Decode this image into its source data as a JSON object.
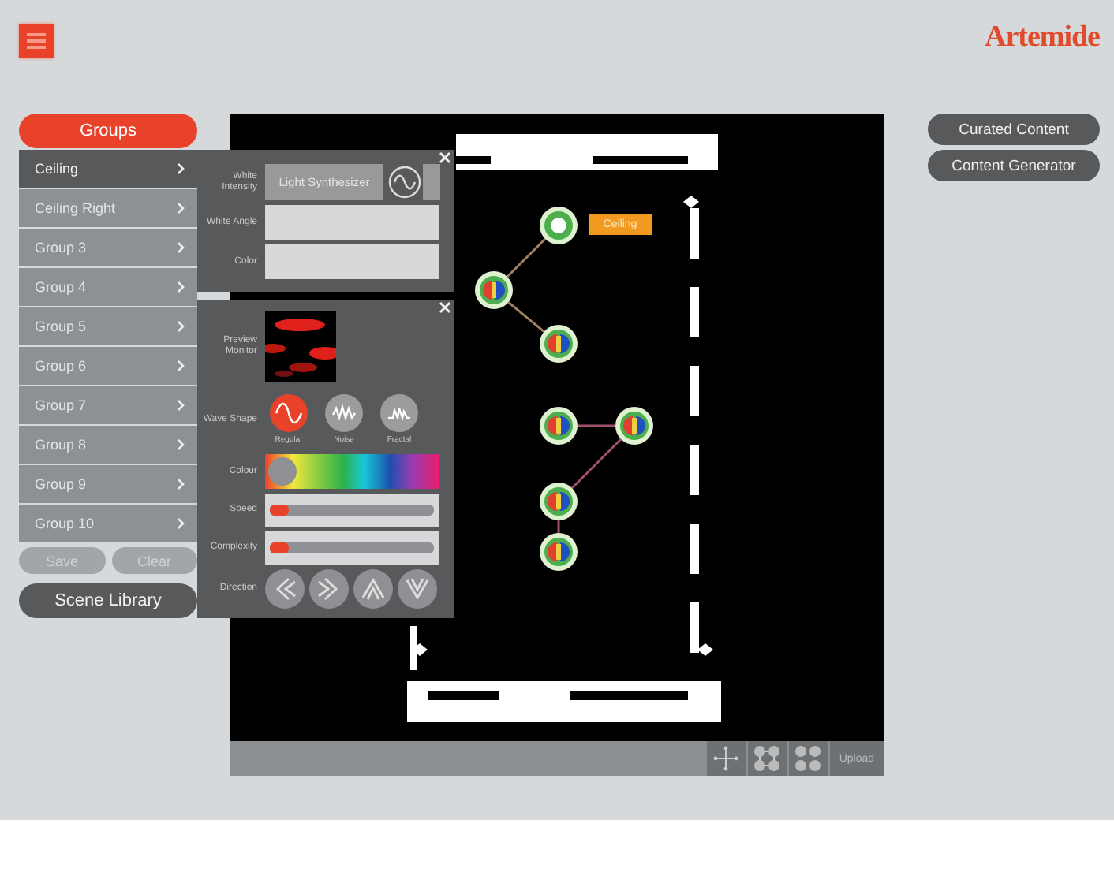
{
  "logo": "Artemide",
  "groups_button": "Groups",
  "groups": [
    {
      "label": "Ceiling",
      "selected": true
    },
    {
      "label": "Ceiling Right",
      "selected": false
    },
    {
      "label": "Group 3",
      "selected": false
    },
    {
      "label": "Group 4",
      "selected": false
    },
    {
      "label": "Group 5",
      "selected": false
    },
    {
      "label": "Group 6",
      "selected": false
    },
    {
      "label": "Group 7",
      "selected": false
    },
    {
      "label": "Group 8",
      "selected": false
    },
    {
      "label": "Group 9",
      "selected": false
    },
    {
      "label": "Group 10",
      "selected": false
    }
  ],
  "actions": [
    "Save",
    "Clear"
  ],
  "scene_library": "Scene Library",
  "right_buttons": [
    "Curated Content",
    "Content Generator"
  ],
  "light_panel": {
    "rows": [
      {
        "label": "White Intensity",
        "value": "Light Synthesizer"
      },
      {
        "label": "White Angle"
      },
      {
        "label": "Color"
      }
    ]
  },
  "wave_panel": {
    "preview_label": "Preview Monitor",
    "wave_label": "Wave Shape",
    "wave_shapes": [
      {
        "label": "Regular",
        "selected": true
      },
      {
        "label": "Noise",
        "selected": false
      },
      {
        "label": "Fractal",
        "selected": false
      }
    ],
    "colour": {
      "label": "Colour",
      "level": 0.04
    },
    "sliders": [
      {
        "label": "Speed",
        "level": 0.12
      },
      {
        "label": "Complexity",
        "level": 0.12
      }
    ],
    "direction_label": "Direction"
  },
  "canvas": {
    "tag": "Ceiling",
    "nodes": [
      {
        "selected": true
      },
      {
        "selected": false
      },
      {
        "selected": false
      },
      {
        "selected": false
      },
      {
        "selected": false
      },
      {
        "selected": false
      },
      {
        "selected": false
      }
    ]
  },
  "toolbar": {
    "upload": "Upload"
  }
}
